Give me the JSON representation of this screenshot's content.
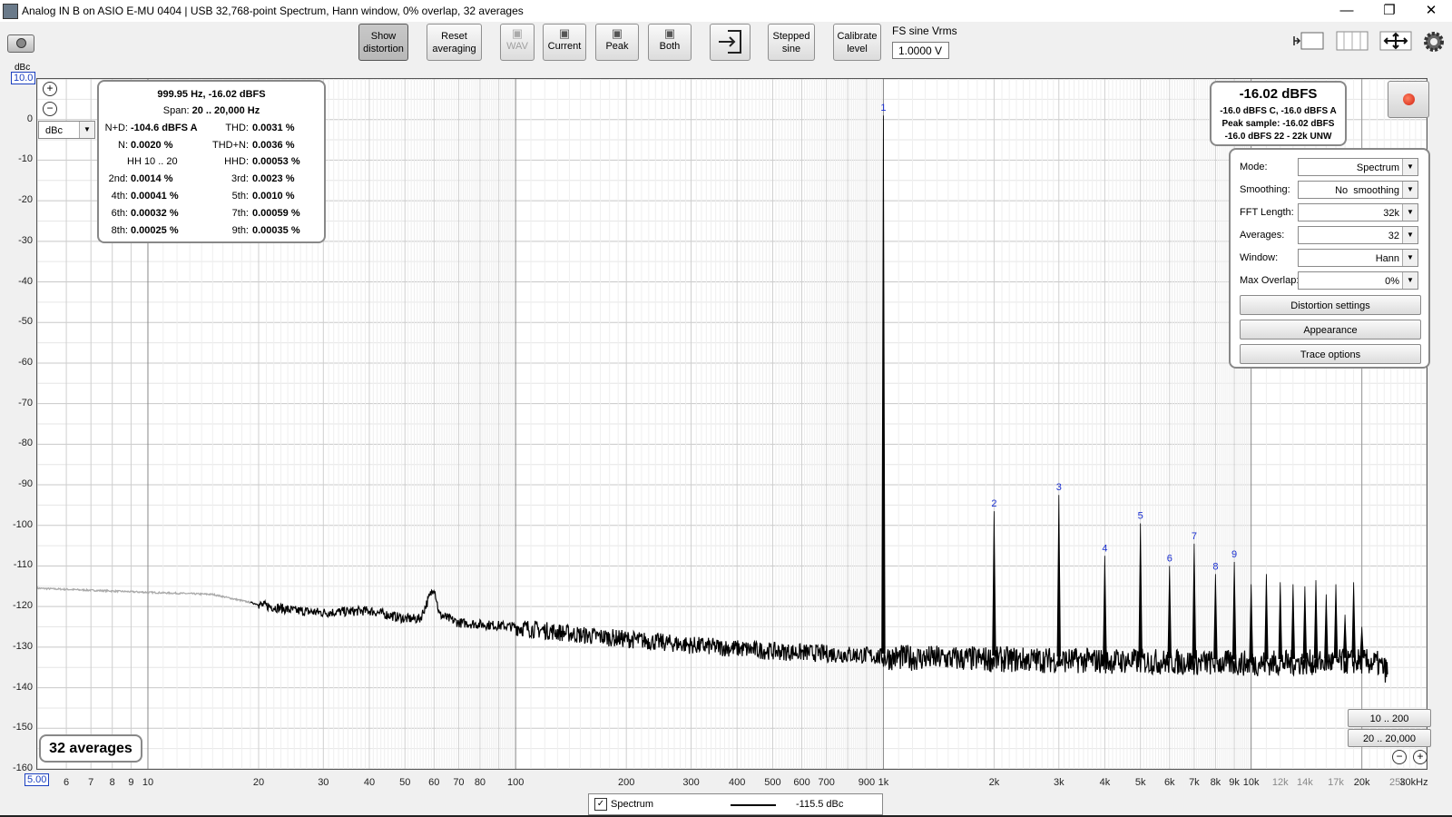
{
  "window": {
    "title": "Analog IN B on ASIO E-MU 0404 | USB 32,768-point Spectrum, Hann window, 0% overlap, 32 averages",
    "minimize": "—",
    "restore": "❐",
    "close": "✕"
  },
  "toolbar": {
    "show_distortion_1": "Show",
    "show_distortion_2": "distortion",
    "reset_averaging_1": "Reset",
    "reset_averaging_2": "averaging",
    "wav": "WAV",
    "current": "Current",
    "peak": "Peak",
    "both": "Both",
    "stepped_sine_1": "Stepped",
    "stepped_sine_2": "sine",
    "calibrate_level_1": "Calibrate",
    "calibrate_level_2": "level",
    "fs_label": "FS sine Vrms",
    "fs_value": "1.0000 V"
  },
  "axis": {
    "y_unit": "dBc",
    "y_top_value": "10.0",
    "x_start_value": "5.00",
    "unit_select": "dBc"
  },
  "distortion": {
    "fundamental": "999.95 Hz, -16.02 dBFS",
    "span_label": "Span:",
    "span_value": "20 .. 20,000 Hz",
    "nd_label": "N+D:",
    "nd_value": "-104.6 dBFS A",
    "thd_label": "THD:",
    "thd_value": "0.0031 %",
    "n_label": "N:",
    "n_value": "0.0020 %",
    "thdn_label": "THD+N:",
    "thdn_value": "0.0036 %",
    "hh_label": "HH 10 .. 20",
    "hhd_label": "HHD:",
    "hhd_value": "0.00053 %",
    "h2_label": "2nd:",
    "h2_value": "0.0014 %",
    "h3_label": "3rd:",
    "h3_value": "0.0023 %",
    "h4_label": "4th:",
    "h4_value": "0.00041 %",
    "h5_label": "5th:",
    "h5_value": "0.0010 %",
    "h6_label": "6th:",
    "h6_value": "0.00032 %",
    "h7_label": "7th:",
    "h7_value": "0.00059 %",
    "h8_label": "8th:",
    "h8_value": "0.00025 %",
    "h9_label": "9th:",
    "h9_value": "0.00035 %"
  },
  "level": {
    "main": "-16.02 dBFS",
    "line1": "-16.0 dBFS C, -16.0 dBFS A",
    "line2": "Peak sample: -16.02 dBFS",
    "line3": "-16.0 dBFS 22 - 22k UNW"
  },
  "settings": {
    "mode_label": "Mode:",
    "mode_value": "Spectrum",
    "smoothing_label": "Smoothing:",
    "smoothing_value": "No  smoothing",
    "fft_label": "FFT Length:",
    "fft_value": "32k",
    "averages_label": "Averages:",
    "averages_value": "32",
    "window_label": "Window:",
    "window_value": "Hann",
    "overlap_label": "Max Overlap:",
    "overlap_value": "0%",
    "distortion_settings": "Distortion settings",
    "appearance": "Appearance",
    "trace_options": "Trace options"
  },
  "ranges": {
    "r1": "10 .. 200",
    "r2": "20 .. 20,000"
  },
  "averages_badge": "32 averages",
  "legend": {
    "name": "Spectrum",
    "value": "-115.5 dBc"
  },
  "chart_data": {
    "type": "line",
    "xscale": "log",
    "xlim": [
      5,
      30000
    ],
    "ylim": [
      -160,
      10
    ],
    "yticks": [
      0,
      -10,
      -20,
      -30,
      -40,
      -50,
      -60,
      -70,
      -80,
      -90,
      -100,
      -110,
      -120,
      -130,
      -140,
      -150,
      -160
    ],
    "xticks": [
      {
        "v": 6,
        "l": "6"
      },
      {
        "v": 7,
        "l": "7"
      },
      {
        "v": 8,
        "l": "8"
      },
      {
        "v": 9,
        "l": "9"
      },
      {
        "v": 10,
        "l": "10"
      },
      {
        "v": 20,
        "l": "20"
      },
      {
        "v": 30,
        "l": "30"
      },
      {
        "v": 40,
        "l": "40"
      },
      {
        "v": 50,
        "l": "50"
      },
      {
        "v": 60,
        "l": "60"
      },
      {
        "v": 70,
        "l": "70"
      },
      {
        "v": 80,
        "l": "80"
      },
      {
        "v": 100,
        "l": "100"
      },
      {
        "v": 200,
        "l": "200"
      },
      {
        "v": 300,
        "l": "300"
      },
      {
        "v": 400,
        "l": "400"
      },
      {
        "v": 500,
        "l": "500"
      },
      {
        "v": 600,
        "l": "600"
      },
      {
        "v": 700,
        "l": "700"
      },
      {
        "v": 900,
        "l": "900"
      },
      {
        "v": 1000,
        "l": "1k"
      },
      {
        "v": 2000,
        "l": "2k"
      },
      {
        "v": 3000,
        "l": "3k"
      },
      {
        "v": 4000,
        "l": "4k"
      },
      {
        "v": 5000,
        "l": "5k"
      },
      {
        "v": 6000,
        "l": "6k"
      },
      {
        "v": 7000,
        "l": "7k"
      },
      {
        "v": 8000,
        "l": "8k"
      },
      {
        "v": 9000,
        "l": "9k"
      },
      {
        "v": 10000,
        "l": "10k"
      },
      {
        "v": 12000,
        "l": "12k",
        "minor": true
      },
      {
        "v": 14000,
        "l": "14k",
        "minor": true
      },
      {
        "v": 17000,
        "l": "17k",
        "minor": true
      },
      {
        "v": 20000,
        "l": "20k"
      },
      {
        "v": 25000,
        "l": "25k",
        "minor": true
      },
      {
        "v": 30000,
        "l": "30kHz"
      }
    ],
    "noise_floor": [
      [
        5,
        -115.5
      ],
      [
        10,
        -116.5
      ],
      [
        15,
        -117
      ],
      [
        19,
        -119
      ],
      [
        20,
        -119.5
      ],
      [
        25,
        -121
      ],
      [
        30,
        -121.5
      ],
      [
        40,
        -121
      ],
      [
        50,
        -123
      ],
      [
        55,
        -123
      ],
      [
        60,
        -115
      ],
      [
        62,
        -122
      ],
      [
        70,
        -124
      ],
      [
        100,
        -125
      ],
      [
        150,
        -127
      ],
      [
        200,
        -128
      ],
      [
        300,
        -129.5
      ],
      [
        500,
        -131
      ],
      [
        900,
        -132
      ],
      [
        1000,
        -132.5
      ],
      [
        2000,
        -133
      ],
      [
        5000,
        -133.5
      ],
      [
        10000,
        -134
      ],
      [
        20000,
        -133.5
      ],
      [
        22000,
        -134
      ],
      [
        23500,
        -136
      ]
    ],
    "faded_below_hz": 19,
    "peaks": [
      {
        "f": 1000,
        "v": 1,
        "label": "1"
      },
      {
        "f": 2000,
        "v": -96.5,
        "label": "2"
      },
      {
        "f": 3000,
        "v": -92.5,
        "label": "3"
      },
      {
        "f": 4000,
        "v": -107.5,
        "label": "4"
      },
      {
        "f": 5000,
        "v": -99.5,
        "label": "5"
      },
      {
        "f": 6000,
        "v": -110,
        "label": "6"
      },
      {
        "f": 7000,
        "v": -104.5,
        "label": "7"
      },
      {
        "f": 8000,
        "v": -112,
        "label": "8"
      },
      {
        "f": 9000,
        "v": -109,
        "label": "9"
      },
      {
        "f": 10000,
        "v": -114.5,
        "label": ""
      },
      {
        "f": 11000,
        "v": -112,
        "label": ""
      },
      {
        "f": 12000,
        "v": -114,
        "label": ""
      },
      {
        "f": 13000,
        "v": -114.5,
        "label": ""
      },
      {
        "f": 14000,
        "v": -115,
        "label": ""
      },
      {
        "f": 15000,
        "v": -113.5,
        "label": ""
      },
      {
        "f": 16000,
        "v": -117,
        "label": ""
      },
      {
        "f": 17000,
        "v": -114.5,
        "label": ""
      },
      {
        "f": 18000,
        "v": -122,
        "label": ""
      },
      {
        "f": 19000,
        "v": -114,
        "label": ""
      },
      {
        "f": 20000,
        "v": -125,
        "label": ""
      }
    ]
  }
}
